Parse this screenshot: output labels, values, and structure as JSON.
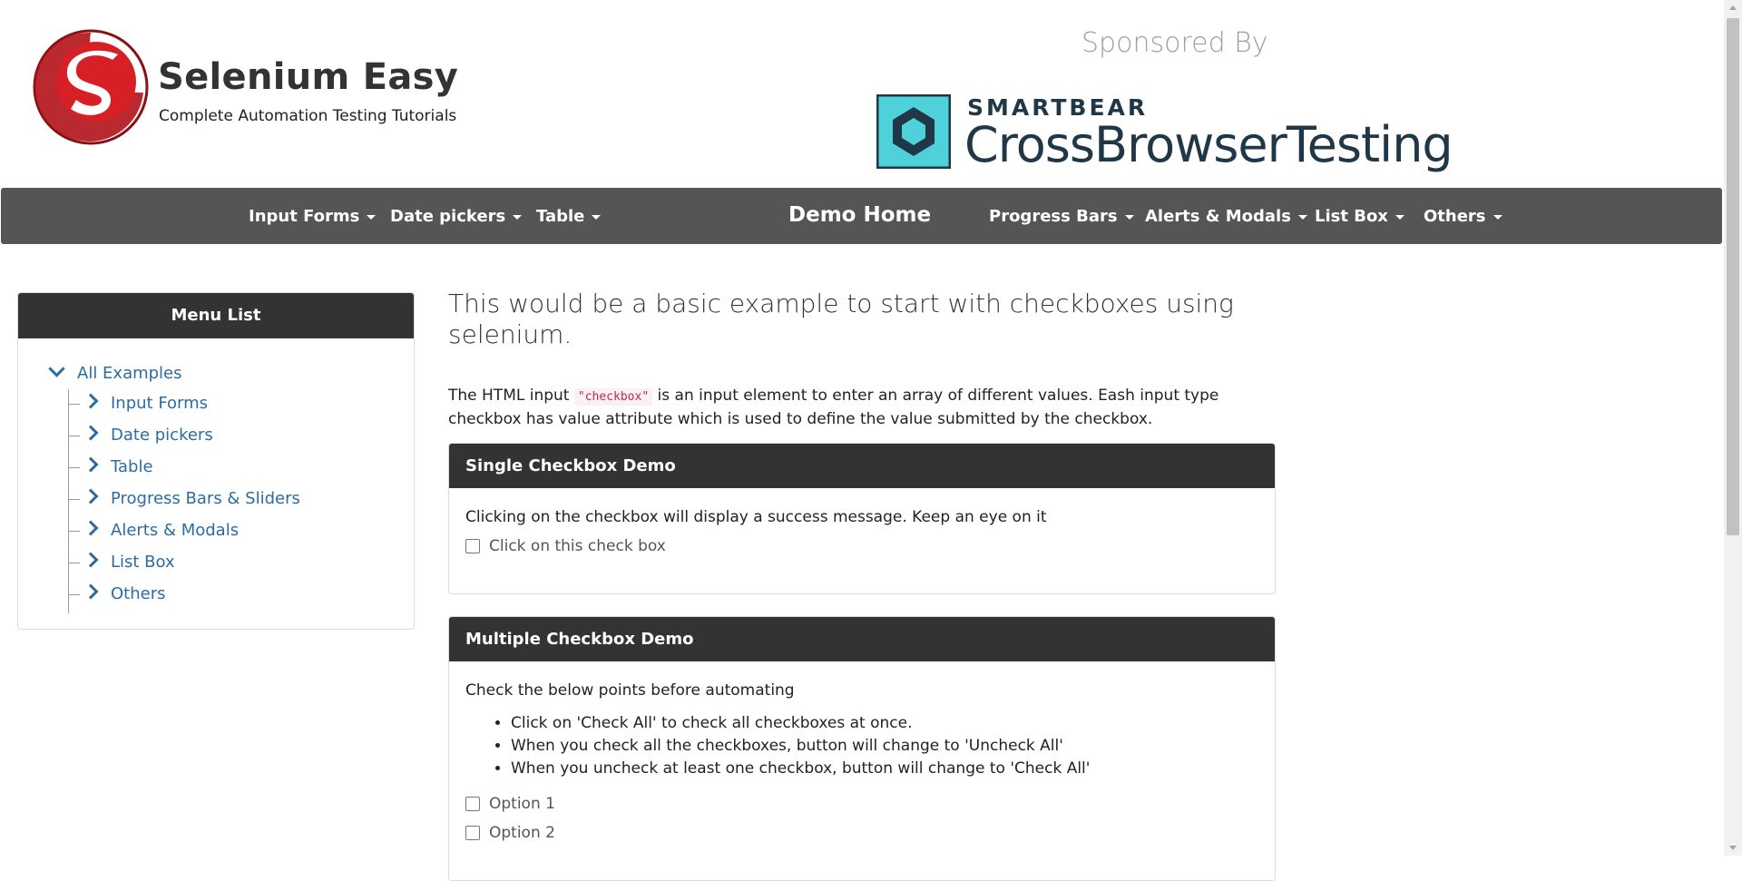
{
  "header": {
    "site_title": "Selenium Easy",
    "tagline": "Complete Automation Testing Tutorials",
    "sponsored_label": "Sponsored By",
    "sponsor_brand": "SMARTBEAR",
    "sponsor_product": "CrossBrowserTesting",
    "colors": {
      "logo_red": "#c4161c",
      "sponsor_teal": "#4fd1d9",
      "sponsor_navy": "#1f3747"
    }
  },
  "navbar": {
    "left_items": [
      {
        "label": "Input Forms"
      },
      {
        "label": "Date pickers"
      },
      {
        "label": "Table"
      }
    ],
    "home_label": "Demo Home",
    "right_items": [
      {
        "label": "Progress Bars"
      },
      {
        "label": "Alerts & Modals"
      },
      {
        "label": "List Box"
      },
      {
        "label": "Others"
      }
    ],
    "background": "#555555"
  },
  "sidebar": {
    "header": "Menu List",
    "root": "All Examples",
    "items": [
      {
        "label": "Input Forms"
      },
      {
        "label": "Date pickers"
      },
      {
        "label": "Table"
      },
      {
        "label": "Progress Bars & Sliders"
      },
      {
        "label": "Alerts & Modals"
      },
      {
        "label": "List Box"
      },
      {
        "label": "Others"
      }
    ],
    "link_color": "#2d6ca2"
  },
  "main": {
    "title": "This would be a basic example to start with checkboxes using selenium.",
    "intro_before_code": "The HTML input ",
    "intro_code": "\"checkbox\"",
    "intro_after_code": " is an input element to enter an array of different values. Eash input type checkbox has value attribute which is used to define the value submitted by the checkbox.",
    "single": {
      "title": "Single Checkbox Demo",
      "description": "Clicking on the checkbox will display a success message. Keep an eye on it",
      "checkbox_label": "Click on this check box",
      "checked": false
    },
    "multiple": {
      "title": "Multiple Checkbox Demo",
      "description": "Check the below points before automating",
      "points": [
        "Click on 'Check All' to check all checkboxes at once.",
        "When you check all the checkboxes, button will change to 'Uncheck All'",
        "When you uncheck at least one checkbox, button will change to 'Check All'"
      ],
      "options": [
        {
          "label": "Option 1",
          "checked": false
        },
        {
          "label": "Option 2",
          "checked": false
        }
      ]
    }
  }
}
